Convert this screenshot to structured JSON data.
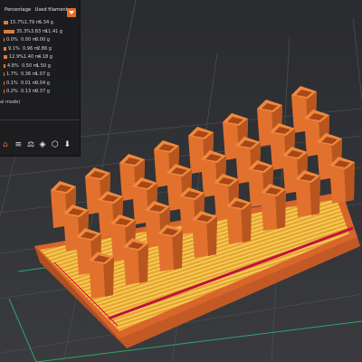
{
  "legend": {
    "col_percentage": "Percentage",
    "col_used": "Used filament",
    "rows": [
      {
        "percent": "15.7%",
        "meters": "1.79 m",
        "grams": "5.34 g",
        "fill": 0.45
      },
      {
        "percent": "35.3%",
        "meters": "3.83 m",
        "grams": "11.41 g",
        "fill": 1.0
      },
      {
        "percent": "0.0%",
        "meters": "0.00 m",
        "grams": "0.00 g",
        "fill": 0.02
      },
      {
        "percent": "9.1%",
        "meters": "0.96 m",
        "grams": "2.86 g",
        "fill": 0.26
      },
      {
        "percent": "12.9%",
        "meters": "1.40 m",
        "grams": "4.18 g",
        "fill": 0.37
      },
      {
        "percent": "4.8%",
        "meters": "0.50 m",
        "grams": "1.50 g",
        "fill": 0.14
      },
      {
        "percent": "1.7%",
        "meters": "0.36 m",
        "grams": "1.07 g",
        "fill": 0.05
      },
      {
        "percent": "0.1%",
        "meters": "0.01 m",
        "grams": "0.04 g",
        "fill": 0.01
      },
      {
        "percent": "0.2%",
        "meters": "0.13 m",
        "grams": "0.37 g",
        "fill": 0.01
      }
    ],
    "note": "al mode)"
  },
  "toolbar": [
    "home-icon",
    "layers-icon",
    "slice-icon",
    "view-icon",
    "cube-icon",
    "export-icon"
  ],
  "colors": {
    "accent": "#e06d2a",
    "model": "#e87a2c",
    "plate": "#2f3034"
  }
}
